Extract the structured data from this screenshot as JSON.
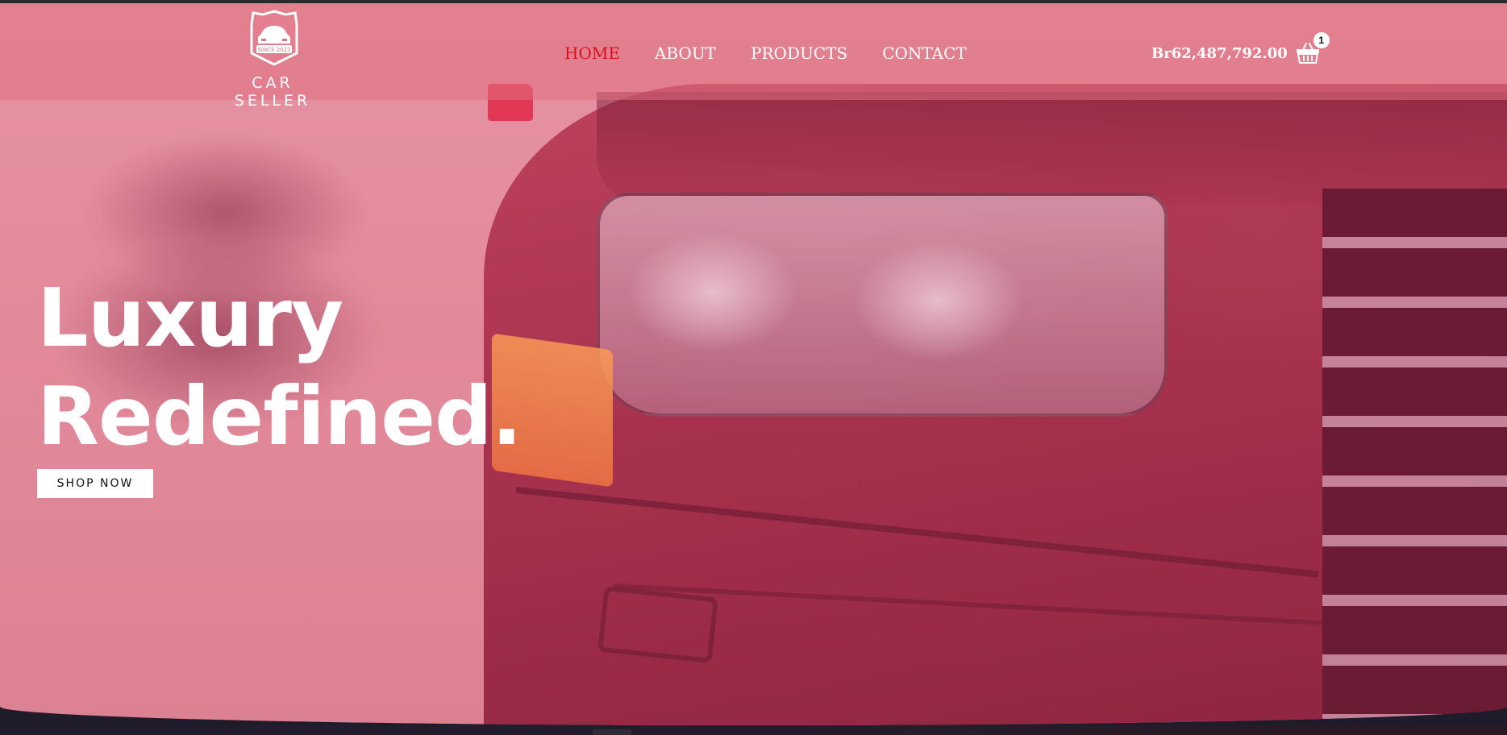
{
  "header": {
    "logo": {
      "emblem_text": "SINCE 2022",
      "name": "CAR SELLER"
    },
    "nav": [
      {
        "label": "HOME",
        "active": true
      },
      {
        "label": "ABOUT",
        "active": false
      },
      {
        "label": "PRODUCTS",
        "active": false
      },
      {
        "label": "CONTACT",
        "active": false
      }
    ],
    "cart": {
      "total": "Br62,487,792.00",
      "count": "1",
      "icon": "basket-icon"
    }
  },
  "hero": {
    "title_line1": "Luxury",
    "title_line2": "Redefined.",
    "cta_label": "SHOP NOW"
  },
  "colors": {
    "accent_active_nav": "#d8101f",
    "header_overlay": "#e07080",
    "hero_tint": "#e48f9f"
  }
}
